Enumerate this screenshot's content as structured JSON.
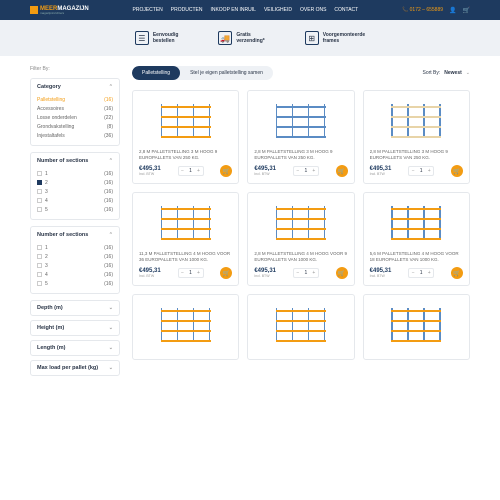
{
  "nav": {
    "brand_top": "MEER",
    "brand_bottom": "MAGAZIJN",
    "brand_sub": "magazijninrichters",
    "links": [
      "PROJECTEN",
      "PRODUCTEN",
      "INKOOP EN INRUIL",
      "VEILIGHEID",
      "OVER ONS",
      "CONTACT"
    ],
    "phone": "0172 – 655889"
  },
  "features": [
    {
      "title": "Eenvoudig",
      "sub": "bestellen"
    },
    {
      "title": "Gratis",
      "sub": "verzending*"
    },
    {
      "title": "Voorgemonteerde",
      "sub": "frames"
    }
  ],
  "filterByLabel": "Filter By:",
  "pills": {
    "active": "Palletstelling",
    "other": "Stel je eigen palletstelling samen"
  },
  "sort": {
    "label": "Sort By:",
    "value": "Newest"
  },
  "category": {
    "title": "Category",
    "items": [
      {
        "label": "Palletstelling",
        "count": "(16)",
        "active": true
      },
      {
        "label": "Accessoires",
        "count": "(16)"
      },
      {
        "label": "Losse onderdelen",
        "count": "(22)"
      },
      {
        "label": "Grondvakstelling",
        "count": "(8)"
      },
      {
        "label": "Injestaltafels",
        "count": "(36)"
      }
    ]
  },
  "sections1": {
    "title": "Number of sections",
    "items": [
      {
        "label": "1",
        "count": "(16)",
        "checked": false
      },
      {
        "label": "2",
        "count": "(16)",
        "checked": true
      },
      {
        "label": "3",
        "count": "(16)",
        "checked": false
      },
      {
        "label": "4",
        "count": "(16)",
        "checked": false
      },
      {
        "label": "5",
        "count": "(16)",
        "checked": false
      }
    ]
  },
  "sections2": {
    "title": "Number of sections",
    "items": [
      {
        "label": "1",
        "count": "(16)",
        "checked": false
      },
      {
        "label": "2",
        "count": "(16)",
        "checked": false
      },
      {
        "label": "3",
        "count": "(16)",
        "checked": false
      },
      {
        "label": "4",
        "count": "(16)",
        "checked": false
      },
      {
        "label": "5",
        "count": "(16)",
        "checked": false
      }
    ]
  },
  "dropdowns": [
    "Depth (m)",
    "Height (m)",
    "Length (m)",
    "Max load per pallet (kg)"
  ],
  "products": [
    {
      "title": "2,8 M PALLETSTELLING 3 M HOOG 9 EUROPALLETS VAN 250 KG.",
      "price": "€495,31",
      "sub": "Incl. BTW",
      "qty": "1"
    },
    {
      "title": "2,8 M PALLETSTELLING 3 M HOOG 9 EUROPALLETS VAN 250 KG.",
      "price": "€495,31",
      "sub": "Incl. BTW",
      "qty": "1"
    },
    {
      "title": "2,8 M PALLETSTELLING 3 M HOOG 9 EUROPALLETS VAN 250 KG.",
      "price": "€495,31",
      "sub": "Incl. BTW",
      "qty": "1"
    },
    {
      "title": "11,3 m palletstelling 4 m hoog voor 36 europallets van 1000 kg.",
      "price": "€495,31",
      "sub": "Incl. BTW",
      "qty": "1"
    },
    {
      "title": "2,8 m palletstelling 4 m hoog voor 9 europallets van 1000 kg.",
      "price": "€495,31",
      "sub": "Incl. BTW",
      "qty": "1"
    },
    {
      "title": "5,6 m palletstelling 4 m hoog voor 18 europallets van 1000 kg.",
      "price": "€495,31",
      "sub": "Incl. BTW",
      "qty": "1"
    }
  ]
}
